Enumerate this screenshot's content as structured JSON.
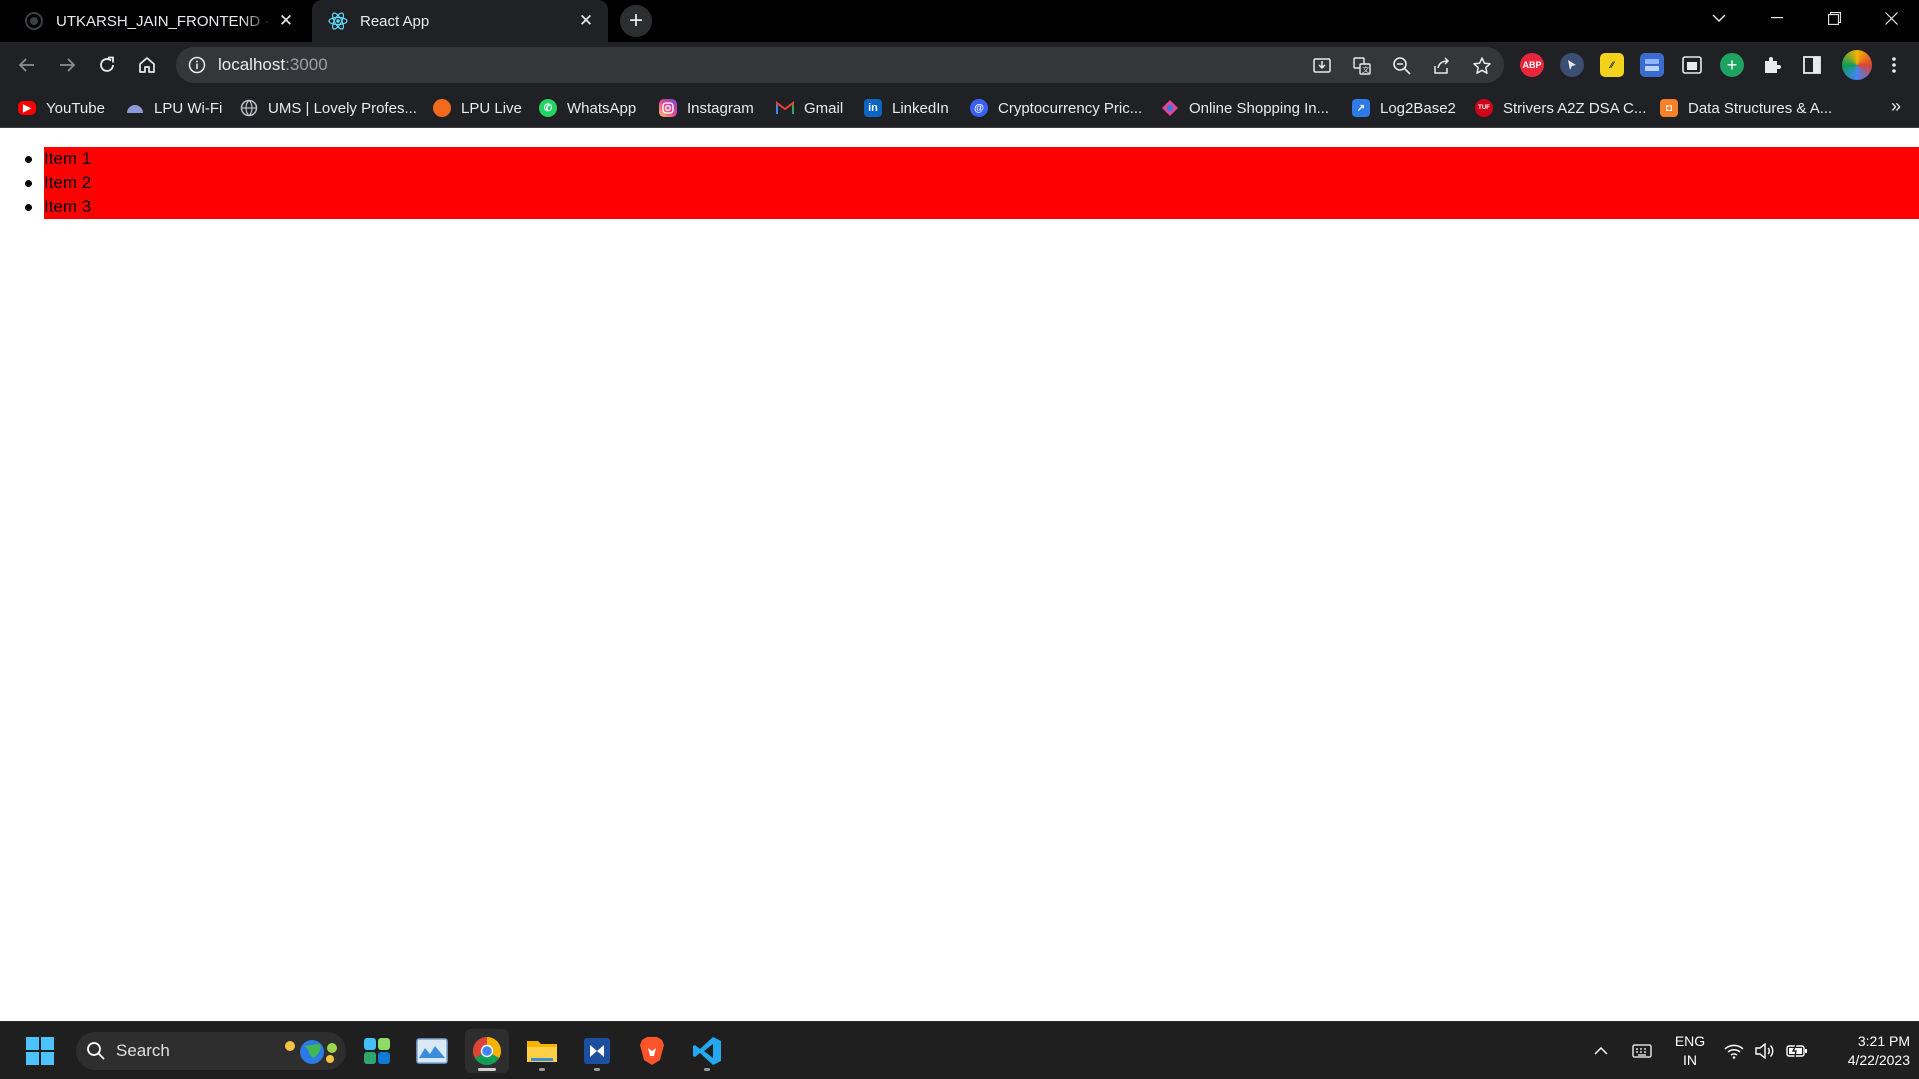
{
  "browser": {
    "tabs": [
      {
        "title": "UTKARSH_JAIN_FRONTEND · Issues",
        "active": false,
        "icon": "github-icon"
      },
      {
        "title": "React App",
        "active": true,
        "icon": "react-icon"
      }
    ],
    "new_tab_label": "+",
    "address": {
      "host": "localhost",
      "port": ":3000"
    },
    "extensions": [
      {
        "name": "adblock-plus-icon",
        "label": "ABP",
        "color": "#e8263b"
      },
      {
        "name": "cursor-extension-icon",
        "label": "",
        "color": "#3b4e73"
      },
      {
        "name": "notes-extension-icon",
        "label": "⁄⁄",
        "color": "#f2d21b"
      },
      {
        "name": "tab-manager-icon",
        "label": "",
        "color": "#3a6ccf"
      },
      {
        "name": "picture-in-picture-icon",
        "label": "",
        "color": "#202124"
      },
      {
        "name": "add-extension-icon",
        "label": "+",
        "color": "#1ea362"
      }
    ]
  },
  "bookmarks": [
    {
      "label": "YouTube",
      "icon": "youtube-icon",
      "color": "#ff0000"
    },
    {
      "label": "LPU Wi-Fi",
      "icon": "wifi-bookmark-icon",
      "color": "#6f7ec2"
    },
    {
      "label": "UMS | Lovely Profes...",
      "icon": "globe-icon",
      "color": "#5f6368"
    },
    {
      "label": "LPU Live",
      "icon": "lpu-live-icon",
      "color": "#f26b1d"
    },
    {
      "label": "WhatsApp",
      "icon": "whatsapp-icon",
      "color": "#25d366"
    },
    {
      "label": "Instagram",
      "icon": "instagram-icon",
      "color": "#d6249f"
    },
    {
      "label": "Gmail",
      "icon": "gmail-icon",
      "color": "#ea4335"
    },
    {
      "label": "LinkedIn",
      "icon": "linkedin-icon",
      "color": "#0a66c2"
    },
    {
      "label": "Cryptocurrency Pric...",
      "icon": "coinmarketcap-icon",
      "color": "#3861fb"
    },
    {
      "label": "Online Shopping In...",
      "icon": "shopping-icon",
      "color": "#e84393"
    },
    {
      "label": "Log2Base2",
      "icon": "log2base2-icon",
      "color": "#2e7be6"
    },
    {
      "label": "Strivers A2Z DSA C...",
      "icon": "striver-icon",
      "color": "#d0021b"
    },
    {
      "label": "Data Structures & A...",
      "icon": "codingninjas-icon",
      "color": "#f5822a"
    }
  ],
  "bookmarks_more": "»",
  "page": {
    "list_items": [
      "Item 1",
      "Item 2",
      "Item 3"
    ],
    "highlight_color": "#ff0000"
  },
  "taskbar": {
    "search_label": "Search",
    "apps": [
      {
        "name": "widgets-app-icon",
        "active": false,
        "running": false
      },
      {
        "name": "photos-app-icon",
        "active": false,
        "running": false
      },
      {
        "name": "chrome-app-icon",
        "active": true,
        "running": true
      },
      {
        "name": "file-explorer-app-icon",
        "active": false,
        "running": true
      },
      {
        "name": "dx-app-icon",
        "active": false,
        "running": true
      },
      {
        "name": "brave-app-icon",
        "active": false,
        "running": false
      },
      {
        "name": "vscode-app-icon",
        "active": false,
        "running": true
      }
    ],
    "language": {
      "line1": "ENG",
      "line2": "IN"
    },
    "clock": {
      "time": "3:21 PM",
      "date": "4/22/2023"
    }
  }
}
